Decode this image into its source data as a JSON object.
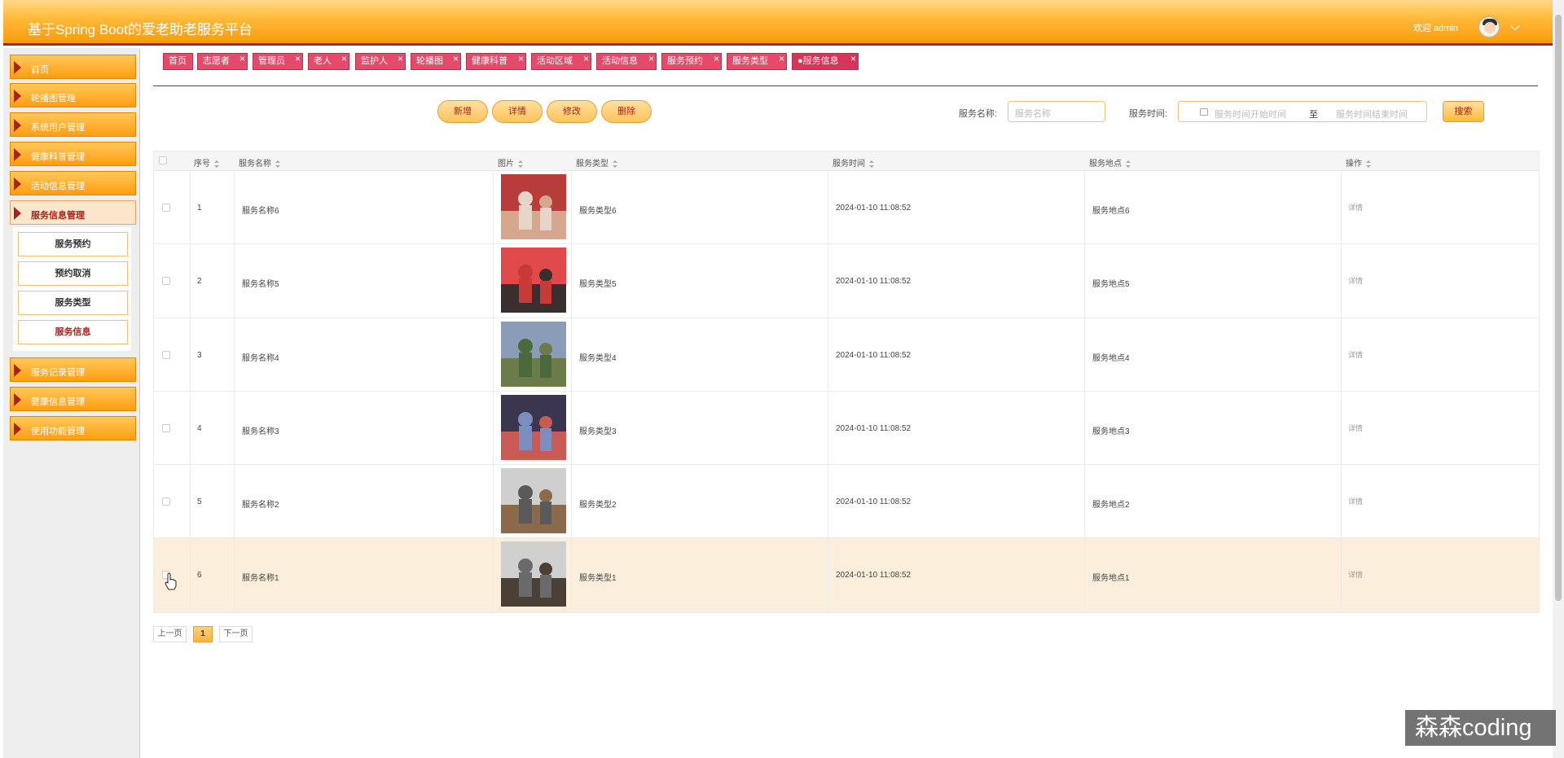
{
  "app": {
    "title": "基于Spring Boot的爱老助老服务平台",
    "welcome": "欢迎 admin"
  },
  "sidebar": {
    "items": [
      {
        "label": "首页"
      },
      {
        "label": "轮播图管理"
      },
      {
        "label": "系统用户管理"
      },
      {
        "label": "健康科普管理"
      },
      {
        "label": "活动信息管理"
      },
      {
        "label": "服务信息管理"
      },
      {
        "label": "服务记录管理"
      },
      {
        "label": "健康信息管理"
      },
      {
        "label": "使用功能管理"
      }
    ],
    "submenu": [
      {
        "label": "服务预约"
      },
      {
        "label": "预约取消"
      },
      {
        "label": "服务类型"
      },
      {
        "label": "服务信息"
      }
    ]
  },
  "tabs": [
    {
      "label": "首页"
    },
    {
      "label": "志愿者"
    },
    {
      "label": "管理员"
    },
    {
      "label": "老人"
    },
    {
      "label": "监护人"
    },
    {
      "label": "轮播图"
    },
    {
      "label": "健康科普"
    },
    {
      "label": "活动区域"
    },
    {
      "label": "活动信息"
    },
    {
      "label": "服务预约"
    },
    {
      "label": "服务类型"
    },
    {
      "label": "●服务信息"
    }
  ],
  "toolbar": {
    "add": "新增",
    "detail": "详情",
    "edit": "修改",
    "delete": "删除",
    "name_label": "服务名称:",
    "name_placeholder": "服务名称",
    "time_label": "服务时间:",
    "time_start_placeholder": "服务时间开始时间",
    "time_sep": "至",
    "time_end_placeholder": "服务时间结束时间",
    "search": "搜索"
  },
  "table": {
    "headers": {
      "index": "序号",
      "name": "服务名称",
      "image": "图片",
      "type": "服务类型",
      "time": "服务时间",
      "place": "服务地点",
      "op": "操作"
    },
    "rows": [
      {
        "index": "1",
        "name": "服务名称6",
        "type": "服务类型6",
        "time": "2024-01-10 11:08:52",
        "place": "服务地点6",
        "op": "详情"
      },
      {
        "index": "2",
        "name": "服务名称5",
        "type": "服务类型5",
        "time": "2024-01-10 11:08:52",
        "place": "服务地点5",
        "op": "详情"
      },
      {
        "index": "3",
        "name": "服务名称4",
        "type": "服务类型4",
        "time": "2024-01-10 11:08:52",
        "place": "服务地点4",
        "op": "详情"
      },
      {
        "index": "4",
        "name": "服务名称3",
        "type": "服务类型3",
        "time": "2024-01-10 11:08:52",
        "place": "服务地点3",
        "op": "详情"
      },
      {
        "index": "5",
        "name": "服务名称2",
        "type": "服务类型2",
        "time": "2024-01-10 11:08:52",
        "place": "服务地点2",
        "op": "详情"
      },
      {
        "index": "6",
        "name": "服务名称1",
        "type": "服务类型1",
        "time": "2024-01-10 11:08:52",
        "place": "服务地点1",
        "op": "详情"
      }
    ]
  },
  "pager": {
    "prev": "上一页",
    "current": "1",
    "next": "下一页"
  },
  "watermark": "森森coding",
  "colors": {
    "accent": "#ffb13a",
    "brand_dark": "#a8211c",
    "tab": "#e64a6a"
  }
}
